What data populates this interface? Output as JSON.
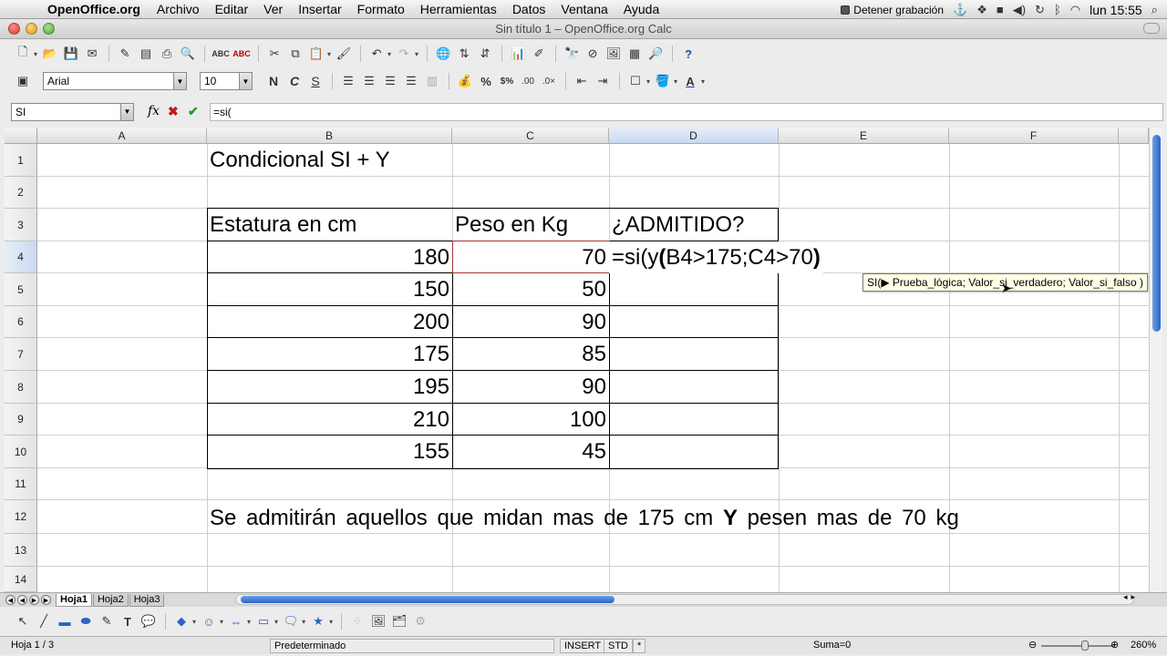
{
  "menubar": {
    "app_name": "OpenOffice.org",
    "items": [
      "Archivo",
      "Editar",
      "Ver",
      "Insertar",
      "Formato",
      "Herramientas",
      "Datos",
      "Ventana",
      "Ayuda"
    ],
    "recording_label": "Detener grabación",
    "clock": "lun 15:55"
  },
  "window": {
    "title": "Sin título 1 – OpenOffice.org Calc"
  },
  "format_toolbar": {
    "font_name": "Arial",
    "font_size": "10",
    "bold": "N",
    "italic": "C",
    "underline": "S"
  },
  "formula_bar": {
    "name_box": "SI",
    "fx": "fx",
    "cancel": "✖",
    "accept": "✔",
    "input": "=si("
  },
  "grid": {
    "columns": [
      "A",
      "B",
      "C",
      "D",
      "E",
      "F"
    ],
    "active_column": "D",
    "rows": [
      "1",
      "2",
      "3",
      "4",
      "5",
      "6",
      "7",
      "8",
      "9",
      "10",
      "11",
      "12",
      "13",
      "14"
    ],
    "active_row": "4",
    "title": "Condicional SI + Y",
    "headers": {
      "estatura": "Estatura en cm",
      "peso": "Peso en Kg",
      "admitido": "¿ADMITIDO?"
    },
    "data": [
      {
        "estatura": "180",
        "peso": "70"
      },
      {
        "estatura": "150",
        "peso": "50"
      },
      {
        "estatura": "200",
        "peso": "90"
      },
      {
        "estatura": "175",
        "peso": "85"
      },
      {
        "estatura": "195",
        "peso": "90"
      },
      {
        "estatura": "210",
        "peso": "100"
      },
      {
        "estatura": "155",
        "peso": "45"
      }
    ],
    "formula_edit": {
      "part1": "=si(y",
      "paren_open": "(",
      "part2": "B4>175;C4>70",
      "paren_close": ")"
    },
    "tooltip": "SI(▶ Prueba_lógica; Valor_si_verdadero; Valor_si_falso )",
    "note": {
      "before": "Se admitirán aquellos que midan mas de 175 cm ",
      "bold": "Y",
      "after": " pesen mas de 70 kg"
    }
  },
  "sheets": {
    "tabs": [
      "Hoja1",
      "Hoja2",
      "Hoja3"
    ],
    "active": "Hoja1"
  },
  "statusbar": {
    "sheet_info": "Hoja 1 / 3",
    "page_style": "Predeterminado",
    "insert_mode": "INSERT",
    "selection_mode": "STD",
    "modified": "*",
    "sum": "Suma=0",
    "zoom": "260%"
  },
  "colors": {
    "accent": "#2a64c7",
    "cancel": "#c21a1a",
    "accept": "#2a9a2a",
    "tooltip_bg": "#ffffe6"
  }
}
